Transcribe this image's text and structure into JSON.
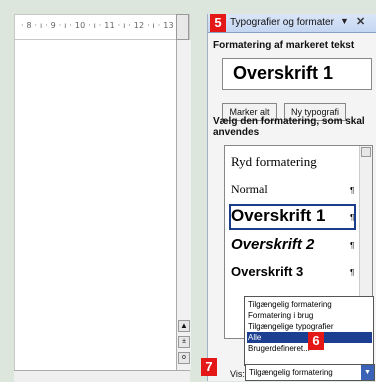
{
  "ruler": {
    "text": "· 8 · ı · 9 · ı · 10 · ı · 11 · ı · 12 · ı · 13 · ı"
  },
  "pane": {
    "title": "Typografier og formater",
    "badge_title": "5",
    "section1_label": "Formatering af markeret tekst",
    "current_format": "Overskrift 1",
    "btn_select_all": "Marker alt",
    "btn_new_style": "Ny typografi",
    "section2_label_line1": "Vælg den formatering, som skal",
    "section2_label_line2": "anvendes"
  },
  "styles_list": [
    {
      "label": "Ryd formatering",
      "pilcrow": ""
    },
    {
      "label": "Normal",
      "pilcrow": "¶"
    },
    {
      "label": "Overskrift 1",
      "pilcrow": "¶"
    },
    {
      "label": "Overskrift 2",
      "pilcrow": "¶"
    },
    {
      "label": "Overskrift 3",
      "pilcrow": "¶"
    }
  ],
  "dropdown": {
    "options": [
      "Tilgængelig formatering",
      "Formatering i brug",
      "Tilgængelige typografier",
      "Alle",
      "Brugerdefineret..."
    ],
    "highlighted_index": 3,
    "badge": "6"
  },
  "vis": {
    "label": "Vis:",
    "value": "Tilgængelig formatering",
    "badge": "7"
  },
  "colors": {
    "badge": "#e51818",
    "highlight": "#1c3f91",
    "title_bar": "#c4d6f1"
  }
}
